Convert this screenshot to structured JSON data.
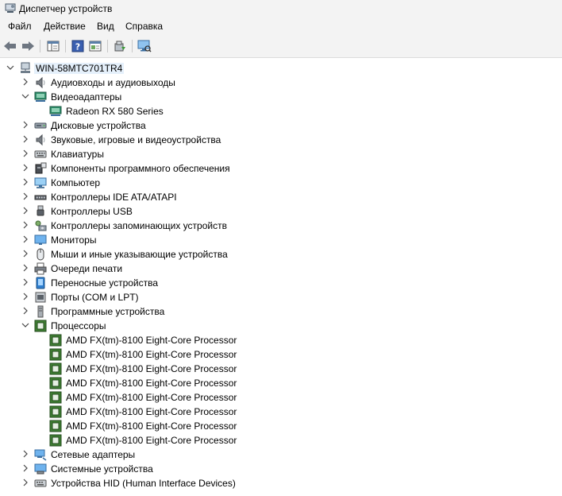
{
  "window": {
    "title": "Диспетчер устройств"
  },
  "menu": [
    "Файл",
    "Действие",
    "Вид",
    "Справка"
  ],
  "tree": {
    "root": "WIN-58MTC701TR4",
    "items": [
      {
        "label": "Аудиовходы и аудиовыходы",
        "icon": "speaker-icon",
        "expanded": false
      },
      {
        "label": "Видеоадаптеры",
        "icon": "display-adapter-icon",
        "expanded": true,
        "children": [
          {
            "label": "Radeon RX 580 Series",
            "icon": "display-adapter-icon"
          }
        ]
      },
      {
        "label": "Дисковые устройства",
        "icon": "disk-drive-icon",
        "expanded": false
      },
      {
        "label": "Звуковые, игровые и видеоустройства",
        "icon": "speaker-icon",
        "expanded": false
      },
      {
        "label": "Клавиатуры",
        "icon": "keyboard-icon",
        "expanded": false
      },
      {
        "label": "Компоненты программного обеспечения",
        "icon": "software-component-icon",
        "expanded": false
      },
      {
        "label": "Компьютер",
        "icon": "computer-icon",
        "expanded": false
      },
      {
        "label": "Контроллеры IDE ATA/ATAPI",
        "icon": "ide-controller-icon",
        "expanded": false
      },
      {
        "label": "Контроллеры USB",
        "icon": "usb-icon",
        "expanded": false
      },
      {
        "label": "Контроллеры запоминающих устройств",
        "icon": "storage-controller-icon",
        "expanded": false
      },
      {
        "label": "Мониторы",
        "icon": "monitor-icon",
        "expanded": false
      },
      {
        "label": "Мыши и иные указывающие устройства",
        "icon": "mouse-icon",
        "expanded": false
      },
      {
        "label": "Очереди печати",
        "icon": "printer-icon",
        "expanded": false
      },
      {
        "label": "Переносные устройства",
        "icon": "portable-device-icon",
        "expanded": false
      },
      {
        "label": "Порты (COM и LPT)",
        "icon": "port-icon",
        "expanded": false
      },
      {
        "label": "Программные устройства",
        "icon": "software-device-icon",
        "expanded": false
      },
      {
        "label": "Процессоры",
        "icon": "processor-icon",
        "expanded": true,
        "children": [
          {
            "label": "AMD FX(tm)-8100 Eight-Core Processor",
            "icon": "processor-icon"
          },
          {
            "label": "AMD FX(tm)-8100 Eight-Core Processor",
            "icon": "processor-icon"
          },
          {
            "label": "AMD FX(tm)-8100 Eight-Core Processor",
            "icon": "processor-icon"
          },
          {
            "label": "AMD FX(tm)-8100 Eight-Core Processor",
            "icon": "processor-icon"
          },
          {
            "label": "AMD FX(tm)-8100 Eight-Core Processor",
            "icon": "processor-icon"
          },
          {
            "label": "AMD FX(tm)-8100 Eight-Core Processor",
            "icon": "processor-icon"
          },
          {
            "label": "AMD FX(tm)-8100 Eight-Core Processor",
            "icon": "processor-icon"
          },
          {
            "label": "AMD FX(tm)-8100 Eight-Core Processor",
            "icon": "processor-icon"
          }
        ]
      },
      {
        "label": "Сетевые адаптеры",
        "icon": "network-adapter-icon",
        "expanded": false
      },
      {
        "label": "Системные устройства",
        "icon": "system-device-icon",
        "expanded": false
      },
      {
        "label": "Устройства HID (Human Interface Devices)",
        "icon": "hid-icon",
        "expanded": false
      }
    ]
  }
}
